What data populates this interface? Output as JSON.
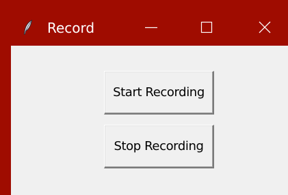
{
  "window": {
    "title": "Record",
    "app_icon": "feather-icon",
    "title_bar_color": "#9f0c00",
    "client_bg_color": "#f0f0f0",
    "controls": {
      "minimize_icon": "minimize-icon",
      "maximize_icon": "maximize-icon",
      "close_icon": "close-icon"
    }
  },
  "buttons": {
    "start_label": "Start Recording",
    "stop_label": "Stop Recording"
  }
}
